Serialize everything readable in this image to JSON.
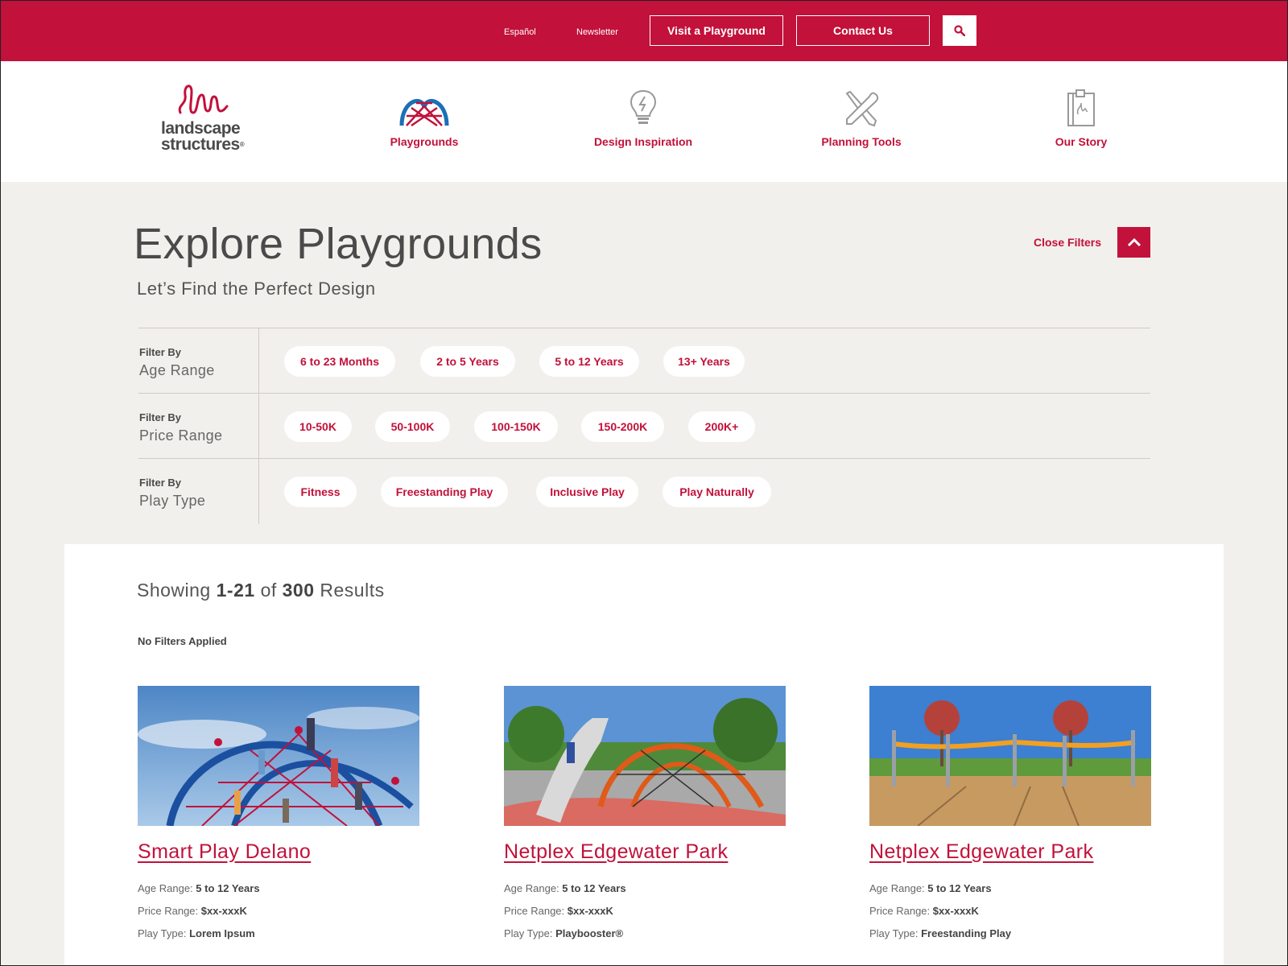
{
  "header": {
    "espanol": "Español",
    "newsletter": "Newsletter",
    "visit_btn": "Visit a Playground",
    "contact_btn": "Contact Us"
  },
  "logo": {
    "line1": "landscape",
    "line2": "structures",
    "reg": "®"
  },
  "nav": [
    {
      "label": "Playgrounds",
      "icon": "playground-arch-icon"
    },
    {
      "label": "Design Inspiration",
      "icon": "lightbulb-icon"
    },
    {
      "label": "Planning Tools",
      "icon": "tools-icon"
    },
    {
      "label": "Our Story",
      "icon": "book-icon"
    }
  ],
  "page": {
    "title": "Explore Playgrounds",
    "subtitle": "Let’s Find the Perfect Design",
    "close_filters": "Close Filters"
  },
  "filters": [
    {
      "by": "Filter By",
      "name": "Age Range",
      "options": [
        "6 to 23 Months",
        "2 to 5 Years",
        "5 to 12 Years",
        "13+ Years"
      ]
    },
    {
      "by": "Filter By",
      "name": "Price Range",
      "options": [
        "10-50K",
        "50-100K",
        "100-150K",
        "150-200K",
        "200K+"
      ]
    },
    {
      "by": "Filter By",
      "name": "Play Type",
      "options": [
        "Fitness",
        "Freestanding Play",
        "Inclusive Play",
        "Play Naturally"
      ]
    }
  ],
  "results": {
    "showing_prefix": "Showing",
    "range": "1-21",
    "of": "of",
    "total": "300",
    "suffix": "Results",
    "filters_status": "No Filters Applied"
  },
  "meta_labels": {
    "age": "Age Range:",
    "price": "Price Range:",
    "type": "Play Type:"
  },
  "cards": [
    {
      "title": "Smart Play Delano",
      "age": "5 to 12 Years",
      "price": "$xx-xxxK",
      "type": "Lorem Ipsum"
    },
    {
      "title": "Netplex Edgewater Park",
      "age": "5 to 12 Years",
      "price": "$xx-xxxK",
      "type": "Playbooster®"
    },
    {
      "title": "Netplex Edgewater Park",
      "age": "5 to 12 Years",
      "price": "$xx-xxxK",
      "type": "Freestanding Play"
    }
  ],
  "colors": {
    "brand": "#c2113a",
    "background": "#f2f0ec"
  }
}
